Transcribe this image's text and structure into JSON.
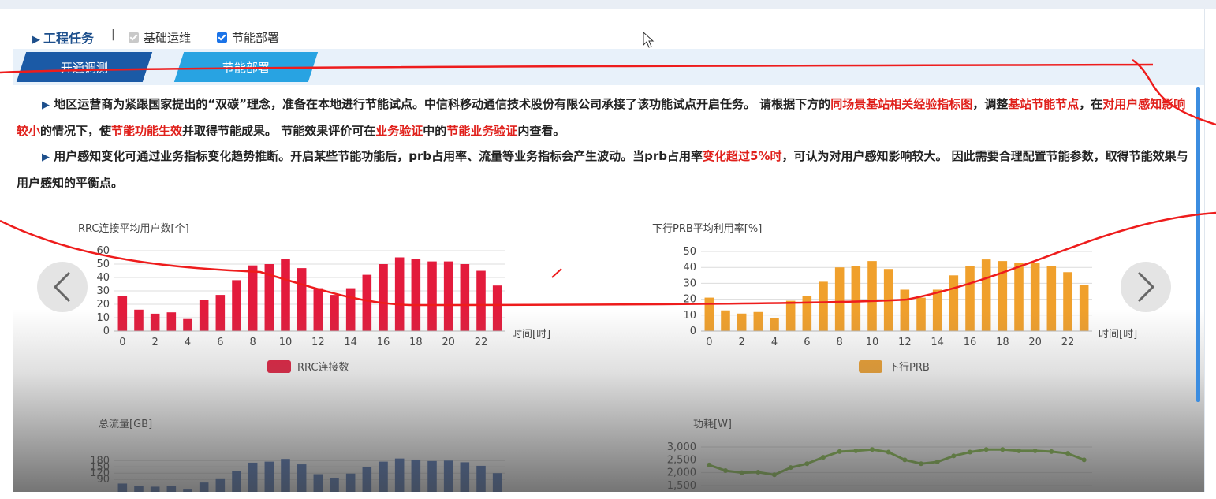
{
  "header": {
    "title": "工程任务",
    "separator": "|",
    "checkbox_basic": {
      "label": "基础运维",
      "checked": true
    },
    "checkbox_energy": {
      "label": "节能部署",
      "checked": true
    }
  },
  "tabs": [
    {
      "label": "开通调测"
    },
    {
      "label": "节能部署"
    }
  ],
  "paragraph1": {
    "s1": "地区运营商为紧跟国家提出的“双碳”理念，准备在本地进行节能试点。中信科移动通信技术股份有限公司承接了该功能试点开启任务。 请根据下方的",
    "r1": "同场景基站相关经验指标图",
    "s2": "，调整",
    "r2": "基站节能节点",
    "s3": "，在",
    "r3": "对用户感知影响较小",
    "s4": "的情况下，使",
    "r4": "节能功能生效",
    "s5": "并取得节能成果。 节能效果评价可在",
    "r5": "业务验证",
    "s6": "中的",
    "r6": "节能业务验证",
    "s7": "内查看。"
  },
  "paragraph2": {
    "s1": "用户感知变化可通过业务指标变化趋势推断。开启某些节能功能后，prb占用率、流量等业务指标会产生波动。当prb占用率",
    "r1": "变化超过5%时",
    "s2": "，可认为对用户感知影响较大。 因此需要合理配置节能参数，取得节能效果与用户感知的平衡点。"
  },
  "colors": {
    "rrc": "#e31b3c",
    "prb": "#f0a02c",
    "traffic": "#3a63ad",
    "power": "#7dbb3b",
    "annotation": "#ee1c1c"
  },
  "chart_data": [
    {
      "type": "bar",
      "title": "RRC连接平均用户数[个]",
      "xlabel": "时间[时]",
      "x": [
        0,
        1,
        2,
        3,
        4,
        5,
        6,
        7,
        8,
        9,
        10,
        11,
        12,
        13,
        14,
        15,
        16,
        17,
        18,
        19,
        20,
        21,
        22,
        23
      ],
      "xticks": [
        "0",
        "2",
        "4",
        "6",
        "8",
        "10",
        "12",
        "14",
        "16",
        "18",
        "20",
        "22"
      ],
      "yticks": [
        "0",
        "10",
        "20",
        "30",
        "40",
        "50",
        "60"
      ],
      "ylim": [
        0,
        60
      ],
      "series": [
        {
          "name": "RRC连接数",
          "values": [
            26,
            16,
            13,
            14,
            9,
            23,
            27,
            38,
            49,
            50,
            54,
            47,
            32,
            27,
            32,
            42,
            50,
            55,
            54,
            52,
            52,
            50,
            45,
            34
          ]
        }
      ]
    },
    {
      "type": "bar",
      "title": "下行PRB平均利用率[%]",
      "xlabel": "时间[时]",
      "x": [
        0,
        1,
        2,
        3,
        4,
        5,
        6,
        7,
        8,
        9,
        10,
        11,
        12,
        13,
        14,
        15,
        16,
        17,
        18,
        19,
        20,
        21,
        22,
        23
      ],
      "xticks": [
        "0",
        "2",
        "4",
        "6",
        "8",
        "10",
        "12",
        "14",
        "16",
        "18",
        "20",
        "22"
      ],
      "yticks": [
        "0",
        "10",
        "20",
        "30",
        "40",
        "50"
      ],
      "ylim": [
        0,
        50
      ],
      "series": [
        {
          "name": "下行PRB",
          "values": [
            21,
            13,
            11,
            12,
            8,
            19,
            22,
            31,
            40,
            41,
            44,
            39,
            26,
            21,
            26,
            35,
            41,
            45,
            44,
            43,
            43,
            41,
            37,
            29
          ]
        }
      ]
    },
    {
      "type": "bar",
      "title": "总流量[GB]",
      "x": [
        0,
        1,
        2,
        3,
        4,
        5,
        6,
        7,
        8,
        9,
        10,
        11,
        12,
        13,
        14,
        15,
        16,
        17,
        18,
        19,
        20,
        21,
        22,
        23
      ],
      "yticks": [
        "90",
        "120",
        "150",
        "180"
      ],
      "series": [
        {
          "values": [
            70,
            60,
            55,
            57,
            45,
            75,
            95,
            132,
            170,
            175,
            188,
            162,
            115,
            98,
            118,
            150,
            175,
            190,
            185,
            178,
            180,
            172,
            155,
            120
          ]
        }
      ]
    },
    {
      "type": "line",
      "title": "功耗[W]",
      "x": [
        0,
        1,
        2,
        3,
        4,
        5,
        6,
        7,
        8,
        9,
        10,
        11,
        12,
        13,
        14,
        15,
        16,
        17,
        18,
        19,
        20,
        21,
        22,
        23
      ],
      "yticks": [
        "1,500",
        "2,000",
        "2,500",
        "3,000"
      ],
      "series": [
        {
          "values": [
            2300,
            2080,
            2000,
            2020,
            1920,
            2200,
            2350,
            2600,
            2820,
            2850,
            2900,
            2800,
            2500,
            2350,
            2420,
            2650,
            2800,
            2900,
            2900,
            2850,
            2850,
            2820,
            2750,
            2500
          ]
        }
      ]
    }
  ]
}
